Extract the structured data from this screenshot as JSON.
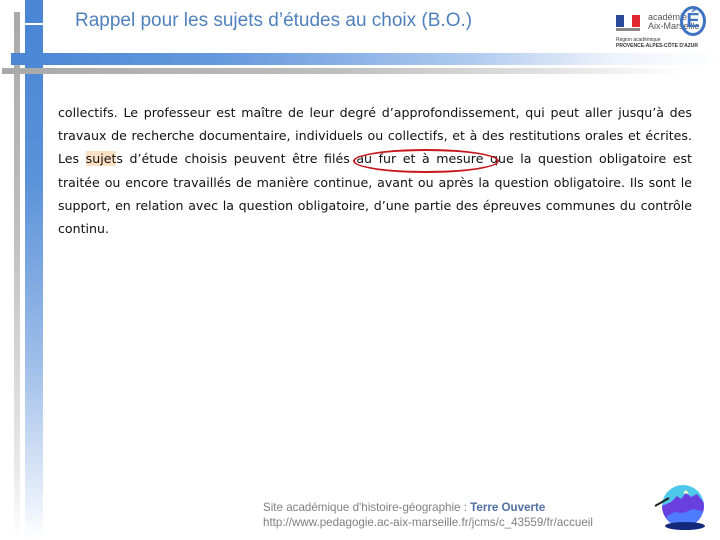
{
  "slide": {
    "title": "Rappel pour les sujets d’études au choix (B.O.)",
    "colors": {
      "title": "#4f81bd",
      "accent_blue": "#4a86d4",
      "accent_gray": "#a9a9a9",
      "highlight": "#fbe0c4",
      "annotation": "#c8161d"
    }
  },
  "logo": {
    "academie_line1": "académie",
    "academie_line2": "Aix-Marseille",
    "e_glyph": "É",
    "region_line1": "Région académique",
    "region_line2": "PROVENCE-ALPES-CÔTE D'AZUR",
    "icon": "academie-logo-icon"
  },
  "content": {
    "before_highlight": "collectifs. Le professeur est maître de leur degré d’approfondissement, qui peut aller jusqu’à des travaux de recherche documentaire, individuels ou collectifs, et à des restitutions orales et écrites. Les ",
    "highlighted_word": "sujet",
    "after_highlight": "s d’étude choisis peuvent ",
    "circled_phrase": "être filés au fur",
    "after_circle": " et à mesure que la question obligatoire est traitée ou encore travaillés de manière continue, avant ou après la question obligatoire. Ils sont le support, en relation avec la question obligatoire, d’une partie des épreuves communes du contrôle continu."
  },
  "footer": {
    "site_label": "Site académique d'histoire-géographie : ",
    "site_name": "Terre Ouverte",
    "url": "http://www.pedagogie.ac-aix-marseille.fr/jcms/c_43559/fr/accueil",
    "icon": "terre-ouverte-logo-icon"
  }
}
